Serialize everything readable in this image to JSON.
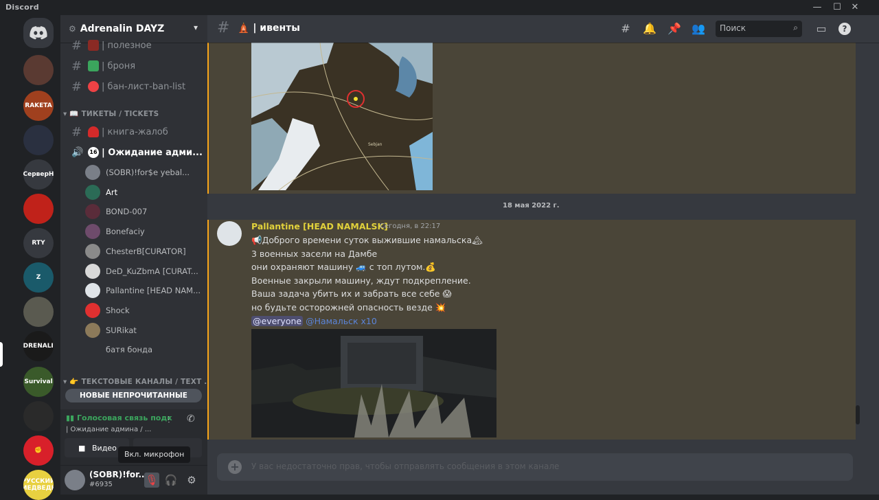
{
  "window": {
    "app_name": "Discord",
    "minimize": "—",
    "maximize": "☐",
    "close": "✕"
  },
  "guild": {
    "name": "Adrenalin DAYZ"
  },
  "channels": [
    {
      "label": "| полезное",
      "color": "#b0403a"
    },
    {
      "label": "| броня",
      "color": "#3ba55d"
    },
    {
      "label": "| бан-лист-ban-list",
      "color": "#ed4245"
    }
  ],
  "categories": {
    "tickets": "ТИКЕТЫ / TICKETS",
    "text": "ТЕКСТОВЫЕ КАНАЛЫ / TEXT ..."
  },
  "ticket_channels": [
    {
      "label": "| книга-жалоб"
    },
    {
      "label": "| Ожидание адми...",
      "badge": "16"
    }
  ],
  "voice_users": [
    {
      "name": "(SOBR)!for$e yebal...",
      "color": "#7a7f88"
    },
    {
      "name": "Art",
      "color": "#2b6b56"
    },
    {
      "name": "BOND-007",
      "color": "#5a2c3a"
    },
    {
      "name": "Bonefaciy",
      "color": "#6e4b6b"
    },
    {
      "name": "ChesterB[CURATOR]",
      "color": "#8a8a8a"
    },
    {
      "name": "DeD_KuZbmA [CURAT...",
      "color": "#d9d9d9"
    },
    {
      "name": "Pallantine [HEAD NAM...",
      "color": "#dfe4e8"
    },
    {
      "name": "Shock",
      "color": "#e03030"
    },
    {
      "name": "SURikat",
      "color": "#8c7a5a"
    },
    {
      "name": "батя бонда",
      "color": ""
    }
  ],
  "unread_pill": "НОВЫЕ НЕПРОЧИТАННЫЕ",
  "voice_panel": {
    "status": "Голосовая связь подк",
    "channel": "| Ожидание админа / ...",
    "video_label": "Видео"
  },
  "tooltip": "Вкл. микрофон",
  "user": {
    "name": "(SOBR)!for...",
    "tag": "#6935"
  },
  "header": {
    "channel_title": "| ивенты",
    "search_placeholder": "Поиск"
  },
  "servers": [
    {
      "label": "",
      "color": "#5a3a32"
    },
    {
      "label": "RAKETA",
      "color": "#a0401e"
    },
    {
      "label": "",
      "color": "#2a3040"
    },
    {
      "label": "СерверН",
      "color": "#36393f"
    },
    {
      "label": "",
      "color": "#c0221a"
    },
    {
      "label": "RTY",
      "color": "#36393f"
    },
    {
      "label": "Z",
      "color": "#1a5a6a"
    },
    {
      "label": "",
      "color": "#5a5a50"
    },
    {
      "label": "ADRENALIN",
      "color": "#1a1a1a"
    },
    {
      "label": "Survival",
      "color": "#3a5a2a"
    },
    {
      "label": "",
      "color": "#2a2a2a"
    },
    {
      "label": "✊",
      "color": "#d8202a"
    },
    {
      "label": "РУССКИЙ МЕДВЕДЬ",
      "color": "#e8d040"
    }
  ],
  "chat": {
    "date_divider": "18 мая 2022 г.",
    "author": "Pallantine [HEAD NAMALSK]",
    "timestamp": "Сегодня, в 22:17",
    "lines": [
      "📢Доброго времени суток выжившие намальска🏔",
      "3 военных засели на Дамбе",
      "они охраняют машину 🚙 с топ лутом.💰",
      "Военные закрыли машину, ждут подкрепление.",
      "Ваша задача убить их и забрать все себе 😱",
      "но будьте осторожней опасность везде 💥"
    ],
    "mention_everyone": "@everyone",
    "mention_role": "@Намальск x10",
    "map_label": "Sebjan"
  },
  "composer": {
    "placeholder": "У вас недостаточно прав, чтобы отправлять сообщения в этом канале"
  }
}
